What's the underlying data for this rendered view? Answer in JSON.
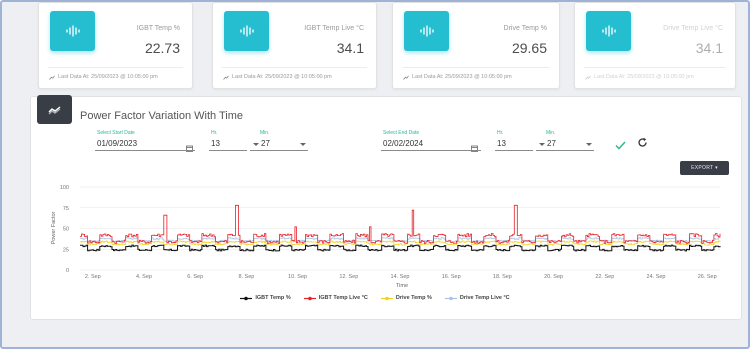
{
  "cards": [
    {
      "title": "IGBT Temp %",
      "value": "22.73",
      "last": "Last Data At: 25/09/2023 @ 10:05:00 pm"
    },
    {
      "title": "IGBT Temp Live °C",
      "value": "34.1",
      "last": "Last Data At: 25/09/2023 @ 10:05:00 pm"
    },
    {
      "title": "Drive Temp %",
      "value": "29.65",
      "last": "Last Data At: 25/09/2023 @ 10:05:00 pm"
    },
    {
      "title": "Drive Temp Live °C",
      "value": "34.1",
      "last": "Last Data At: 25/09/2023 @ 10:05:00 pm"
    }
  ],
  "panel": {
    "title": "Power Factor Variation With Time",
    "start_label": "Select Start Date",
    "start_date": "01/09/2023",
    "start_hr_label": "Hr.",
    "start_hr": "13",
    "start_min_label": "Min.",
    "start_min": "27",
    "end_label": "Select End Date",
    "end_date": "02/02/2024",
    "end_hr_label": "Hr.",
    "end_hr": "13",
    "end_min_label": "Min.",
    "end_min": "27",
    "export_label": "EXPORT"
  },
  "colors": {
    "accent": "#25bdd0",
    "dark": "#383d46",
    "label_green": "#26b89a"
  },
  "chart_data": {
    "type": "line",
    "xlabel": "Time",
    "ylabel": "Power Factor",
    "ylim": [
      0,
      100
    ],
    "yticks": [
      "0",
      "25",
      "50",
      "75",
      "100"
    ],
    "xticks": [
      "2. Sep",
      "4. Sep",
      "6. Sep",
      "8. Sep",
      "10. Sep",
      "12. Sep",
      "14. Sep",
      "16. Sep",
      "18. Sep",
      "20. Sep",
      "22. Sep",
      "24. Sep",
      "26. Sep"
    ],
    "xrange_days": [
      1.5,
      26.5
    ],
    "series": [
      {
        "name": "IGBT Temp %",
        "color": "#111111",
        "base": 24,
        "high": 29,
        "spikes": []
      },
      {
        "name": "IGBT Temp Live °C",
        "color": "#e8202a",
        "base": 34,
        "high": 42,
        "spikes": [
          [
            4.8,
            66
          ],
          [
            7.6,
            78
          ],
          [
            14.5,
            72
          ],
          [
            18.5,
            78
          ],
          [
            9.9,
            52
          ],
          [
            12.8,
            52
          ]
        ]
      },
      {
        "name": "Drive Temp %",
        "color": "#f2d21b",
        "base": 31,
        "high": 34,
        "spikes": []
      },
      {
        "name": "Drive Temp Live °C",
        "color": "#a9c4e6",
        "base": 35,
        "high": 38,
        "spikes": []
      }
    ]
  }
}
